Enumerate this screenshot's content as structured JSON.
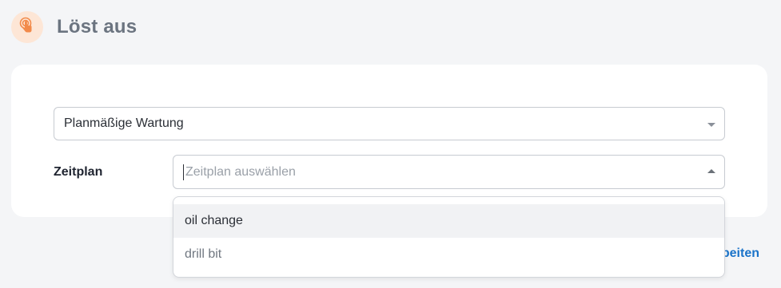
{
  "header": {
    "title": "Löst aus",
    "icon": "touch-trigger-icon",
    "icon_color": "#f28a4a"
  },
  "trigger_select": {
    "value": "Planmäßige Wartung"
  },
  "schedule": {
    "label": "Zeitplan",
    "placeholder": "Zeitplan auswählen"
  },
  "dropdown": {
    "options": [
      {
        "label": "oil change",
        "highlighted": true
      },
      {
        "label": "drill bit",
        "highlighted": false
      }
    ]
  },
  "footer": {
    "edit_link_visible": "beiten"
  },
  "colors": {
    "accent_link": "#1a73c9",
    "badge_bg": "#fde6d6"
  }
}
